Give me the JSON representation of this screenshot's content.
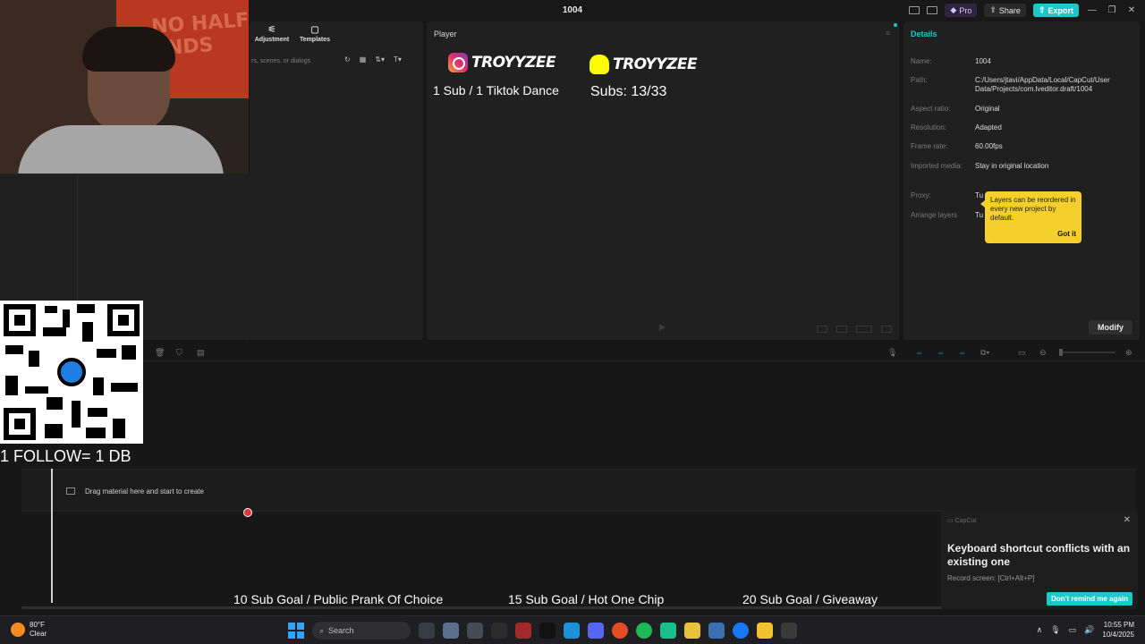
{
  "titlebar": {
    "doc_title": "1004",
    "pro_label": "Pro",
    "share_label": "Share",
    "export_label": "Export",
    "accent": "#1fc8c8"
  },
  "webcam": {
    "banner_text": "NO HALF\nENDS"
  },
  "media": {
    "tabs": [
      {
        "label": "Adjustment",
        "icon": "sliders-icon"
      },
      {
        "label": "Templates",
        "icon": "templates-icon"
      }
    ],
    "search_placeholder": "rs, scenes, or dialogs"
  },
  "player": {
    "label": "Player",
    "brand_left": "TROYYZEE",
    "brand_right": "TROYYZEE",
    "overlay_left": "1 Sub / 1 Tiktok Dance",
    "overlay_right": "Subs: 13/33"
  },
  "details": {
    "title": "Details",
    "rows": [
      {
        "key": "Name:",
        "value": "1004"
      },
      {
        "key": "Path:",
        "value": "C:/Users/jtavi/AppData/Local/CapCut/User Data/Projects/com.lveditor.draft/1004"
      },
      {
        "key": "Aspect ratio:",
        "value": "Original"
      },
      {
        "key": "Resolution:",
        "value": "Adapted"
      },
      {
        "key": "Frame rate:",
        "value": "60.00fps"
      },
      {
        "key": "Imported media:",
        "value": "Stay in original location"
      },
      {
        "key": "Proxy:",
        "value": "Tu"
      },
      {
        "key": "Arrange layers",
        "value": "Tu"
      }
    ],
    "modify_label": "Modify"
  },
  "tooltip": {
    "text": "Layers can be reordered in every new project by default.",
    "button": "Got it"
  },
  "timeline": {
    "drag_hint": "Drag material here and start to create"
  },
  "overlay": {
    "follow_text": "1 FOLLOW= 1 DB",
    "goals": [
      "10 Sub Goal / Public Prank Of Choice",
      "15 Sub Goal / Hot One Chip",
      "20 Sub Goal / Giveaway"
    ]
  },
  "toast": {
    "source": "CapCut",
    "message": "Keyboard shortcut conflicts with an existing one",
    "detail": "Record screen: [Ctrl+Alt+P]",
    "dismiss_label": "Don't remind me again"
  },
  "taskbar": {
    "temperature": "80°F",
    "condition": "Clear",
    "search_placeholder": "Search",
    "time": "10:55 PM",
    "date": "10/4/2025"
  }
}
